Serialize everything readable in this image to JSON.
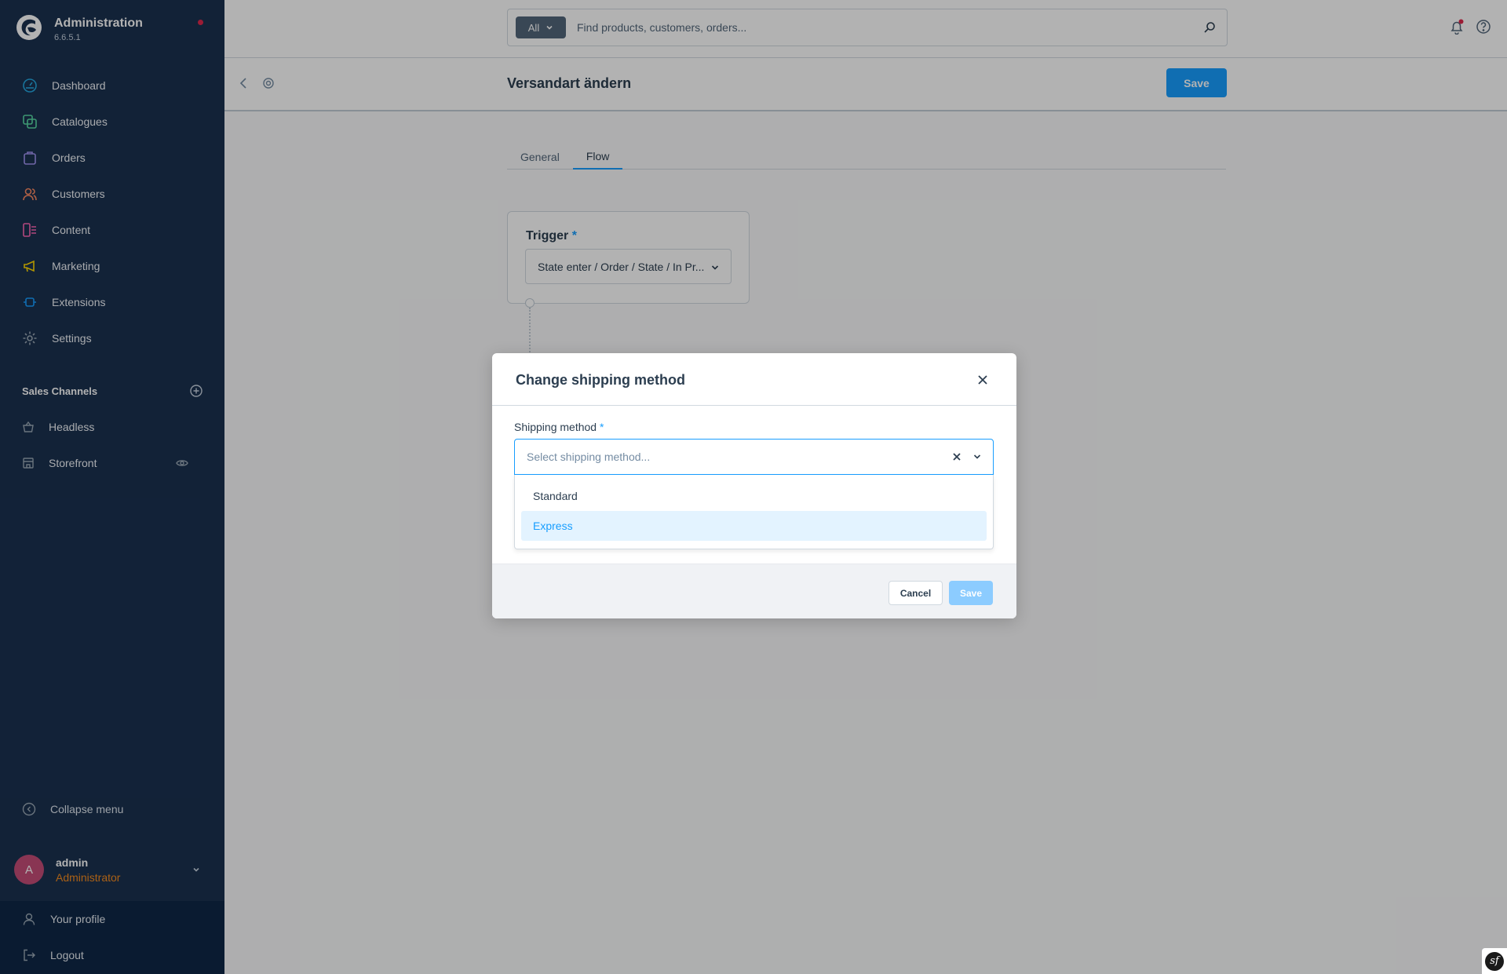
{
  "app": {
    "title": "Administration",
    "version": "6.6.5.1"
  },
  "nav": {
    "items": [
      {
        "label": "Dashboard",
        "icon": "dashboard-icon",
        "color": "#25a6de"
      },
      {
        "label": "Catalogues",
        "icon": "catalogues-icon",
        "color": "#57d9a3"
      },
      {
        "label": "Orders",
        "icon": "orders-icon",
        "color": "#a092f0"
      },
      {
        "label": "Customers",
        "icon": "customers-icon",
        "color": "#f88962"
      },
      {
        "label": "Content",
        "icon": "content-icon",
        "color": "#ff68b4"
      },
      {
        "label": "Marketing",
        "icon": "marketing-icon",
        "color": "#ffd700"
      },
      {
        "label": "Extensions",
        "icon": "extensions-icon",
        "color": "#189eff"
      },
      {
        "label": "Settings",
        "icon": "settings-icon",
        "color": "#9aa8b5"
      }
    ]
  },
  "sales_channels": {
    "heading": "Sales Channels",
    "items": [
      {
        "label": "Headless",
        "icon": "basket-icon"
      },
      {
        "label": "Storefront",
        "icon": "storefront-icon"
      }
    ]
  },
  "sidebar_footer": {
    "collapse_label": "Collapse menu",
    "user_name": "admin",
    "user_role": "Administrator",
    "avatar_initial": "A",
    "profile_label": "Your profile",
    "logout_label": "Logout"
  },
  "search": {
    "type_label": "All",
    "placeholder": "Find products, customers, orders..."
  },
  "smartbar": {
    "title": "Versandart ändern",
    "save_label": "Save"
  },
  "tabs": [
    {
      "label": "General",
      "active": false
    },
    {
      "label": "Flow",
      "active": true
    }
  ],
  "trigger": {
    "label": "Trigger",
    "required_mark": "*",
    "value": "State enter / Order / State / In Pr..."
  },
  "modal": {
    "title": "Change shipping method",
    "field_label": "Shipping method",
    "required_mark": "*",
    "placeholder": "Select shipping method...",
    "options": [
      {
        "label": "Standard",
        "highlighted": false
      },
      {
        "label": "Express",
        "highlighted": true
      }
    ],
    "cancel_label": "Cancel",
    "save_label": "Save"
  },
  "colors": {
    "sidebar": "#1a3150",
    "accent": "#189eff",
    "role": "#f58b1f",
    "avatar": "#c54c77"
  }
}
